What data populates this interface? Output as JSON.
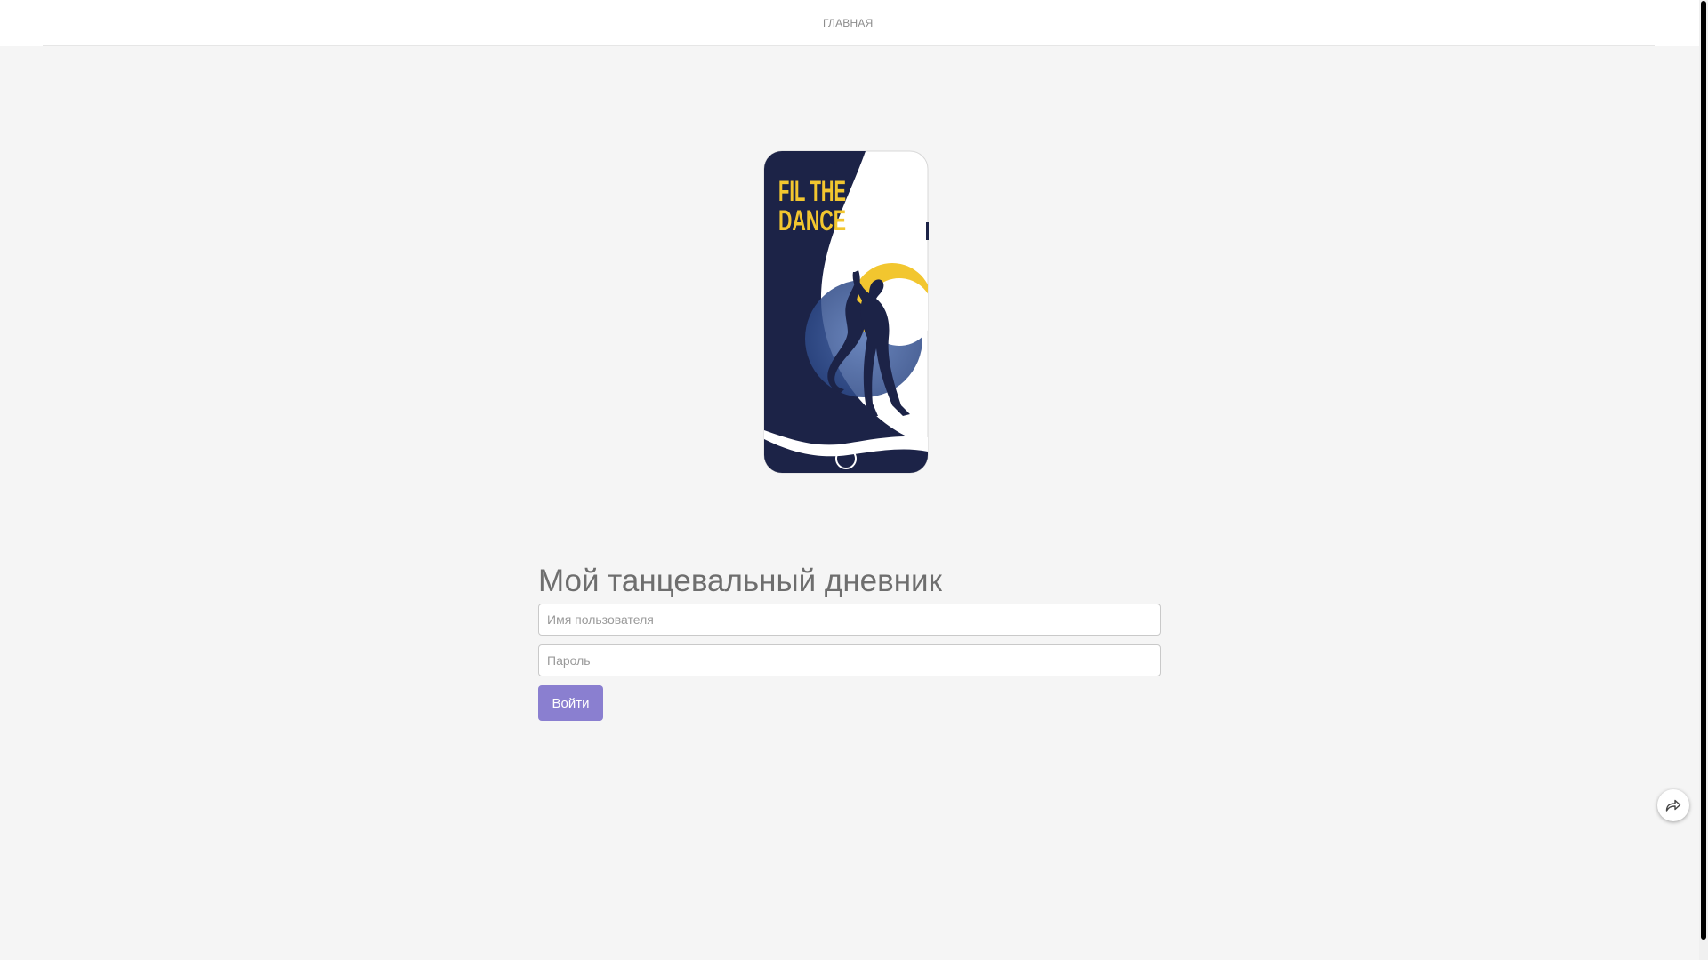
{
  "nav": {
    "home_label": "ГЛАВНАЯ"
  },
  "hero": {
    "phone_text_line1": "FIL THE",
    "phone_text_line2": "DANCE"
  },
  "login": {
    "title": "Мой танцевальный дневник",
    "username_placeholder": "Имя пользователя",
    "password_placeholder": "Пароль",
    "submit_label": "Войти"
  },
  "icons": {
    "share": "share-arrow-icon"
  },
  "colors": {
    "page_background": "#f5f5f5",
    "header_background": "#ffffff",
    "accent_button": "#8a7fd0",
    "phone_navy": "#1c2347",
    "phone_yellow": "#f2c62f",
    "phone_blue": "#3a5a9e"
  }
}
